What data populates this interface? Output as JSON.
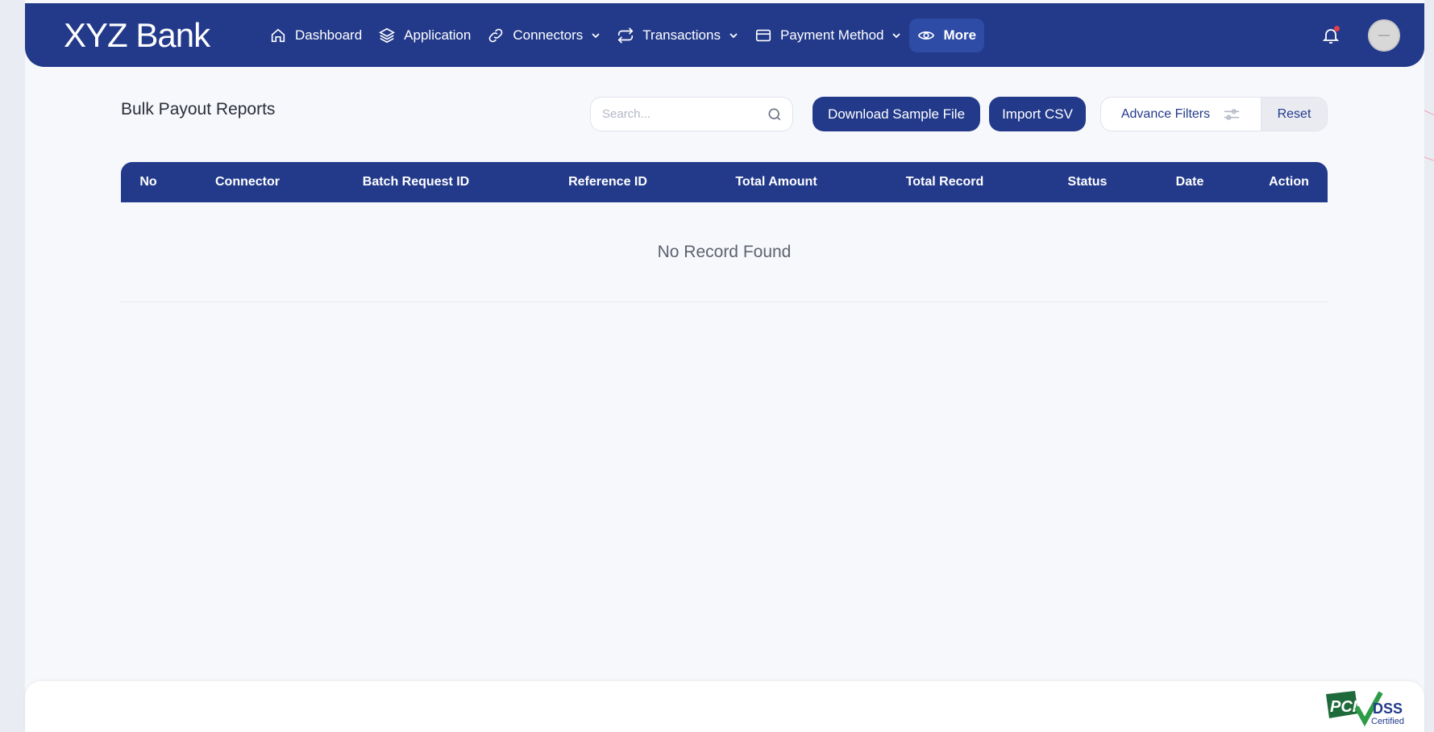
{
  "brand": {
    "name": "XYZ Bank"
  },
  "nav": {
    "items": [
      {
        "label": "Dashboard",
        "icon": "home-icon",
        "has_dropdown": false,
        "active": false
      },
      {
        "label": "Application",
        "icon": "layers-icon",
        "has_dropdown": false,
        "active": false
      },
      {
        "label": "Connectors",
        "icon": "link-icon",
        "has_dropdown": true,
        "active": false
      },
      {
        "label": "Transactions",
        "icon": "repeat-icon",
        "has_dropdown": true,
        "active": false
      },
      {
        "label": "Payment Method",
        "icon": "credit-card-icon",
        "has_dropdown": true,
        "active": false
      },
      {
        "label": "More",
        "icon": "eye-icon",
        "has_dropdown": false,
        "active": true
      }
    ],
    "notifications_icon": "bell-icon",
    "has_unread_notification": true,
    "avatar_icon": "avatar"
  },
  "page": {
    "title": "Bulk Payout Reports",
    "search_placeholder": "Search...",
    "search_icon": "search-icon",
    "download_sample_label": "Download Sample File",
    "import_csv_label": "Import CSV",
    "advance_filters_label": "Advance Filters",
    "advance_filters_icon": "sliders-icon",
    "reset_label": "Reset"
  },
  "table": {
    "columns": [
      "No",
      "Connector",
      "Batch Request ID",
      "Reference ID",
      "Total Amount",
      "Total Record",
      "Status",
      "Date",
      "Action"
    ],
    "rows": [],
    "empty_text": "No Record Found"
  },
  "footer": {
    "logo": "pci-dss-certified-logo",
    "logo_text": "PCI DSS Certified"
  },
  "colors": {
    "primary": "#233a8b",
    "background": "#f7f8fb",
    "notification_dot": "#e43d4b",
    "pci_green": "#2e9b47"
  }
}
